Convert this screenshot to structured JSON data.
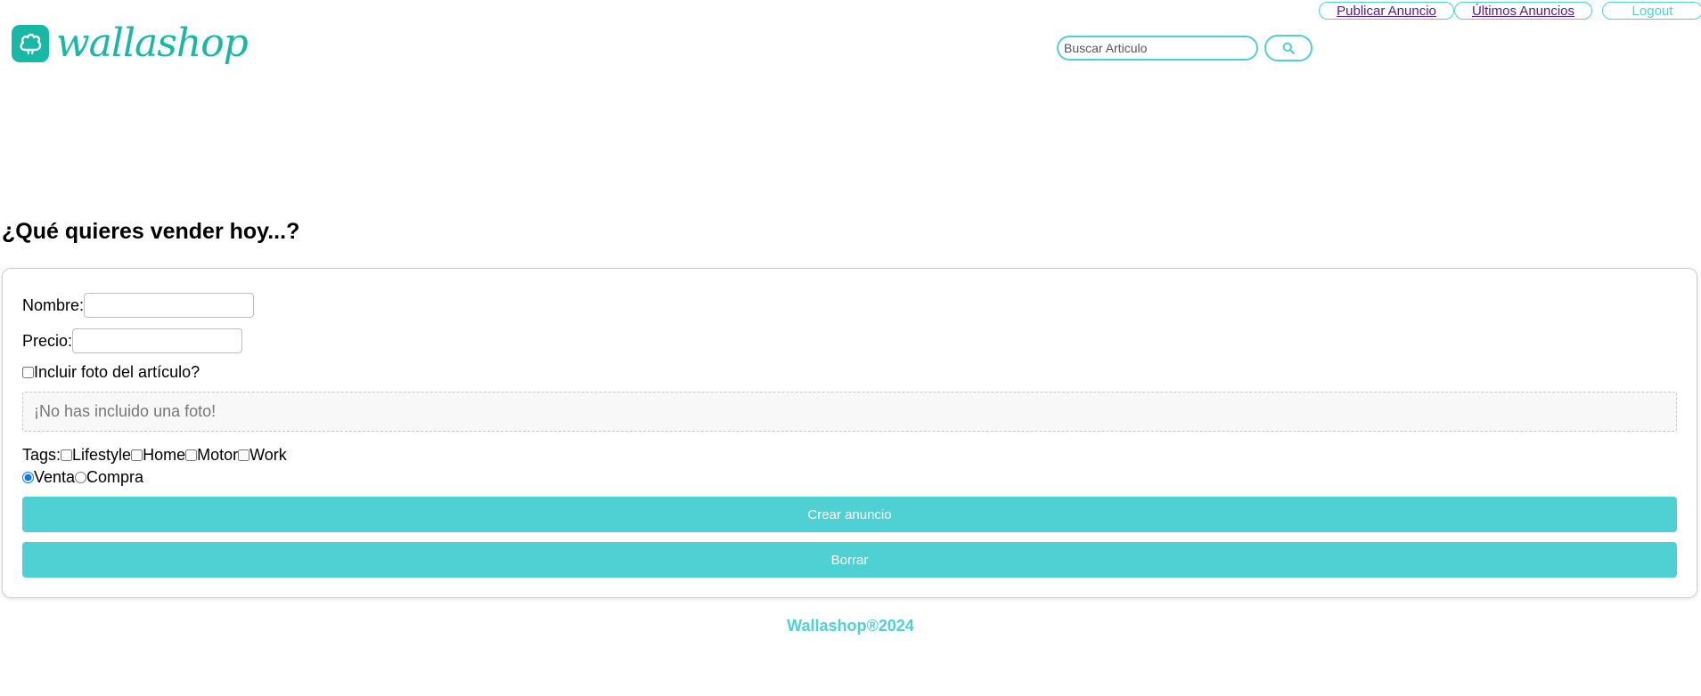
{
  "brand": {
    "name": "wallashop"
  },
  "search": {
    "placeholder": "Buscar Articulo",
    "value": ""
  },
  "nav": {
    "publicar": "Publicar Anuncio",
    "ultimos": "Últimos Anuncios",
    "logout": "Logout"
  },
  "page": {
    "title": "¿Qué quieres vender hoy...?"
  },
  "form": {
    "nombre_label": "Nombre:",
    "nombre_value": "",
    "precio_label": "Precio:",
    "precio_value": "",
    "photo_label": "Incluir foto del artículo?",
    "photo_checked": false,
    "no_photo_text": "¡No has incluido una foto!",
    "tags_label": "Tags:",
    "tags": [
      {
        "label": "Lifestyle",
        "checked": false
      },
      {
        "label": "Home",
        "checked": false
      },
      {
        "label": "Motor",
        "checked": false
      },
      {
        "label": "Work",
        "checked": false
      }
    ],
    "type_options": [
      {
        "label": "Venta",
        "checked": true
      },
      {
        "label": "Compra",
        "checked": false
      }
    ],
    "submit_label": "Crear anuncio",
    "reset_label": "Borrar"
  },
  "footer": {
    "text": "Wallashop®2024"
  },
  "colors": {
    "accent": "#4fd1d3",
    "brand": "#17b8a6",
    "link": "#551a8b"
  },
  "icons": {
    "logo": "popcorn-cloud-icon",
    "search": "search-icon"
  }
}
